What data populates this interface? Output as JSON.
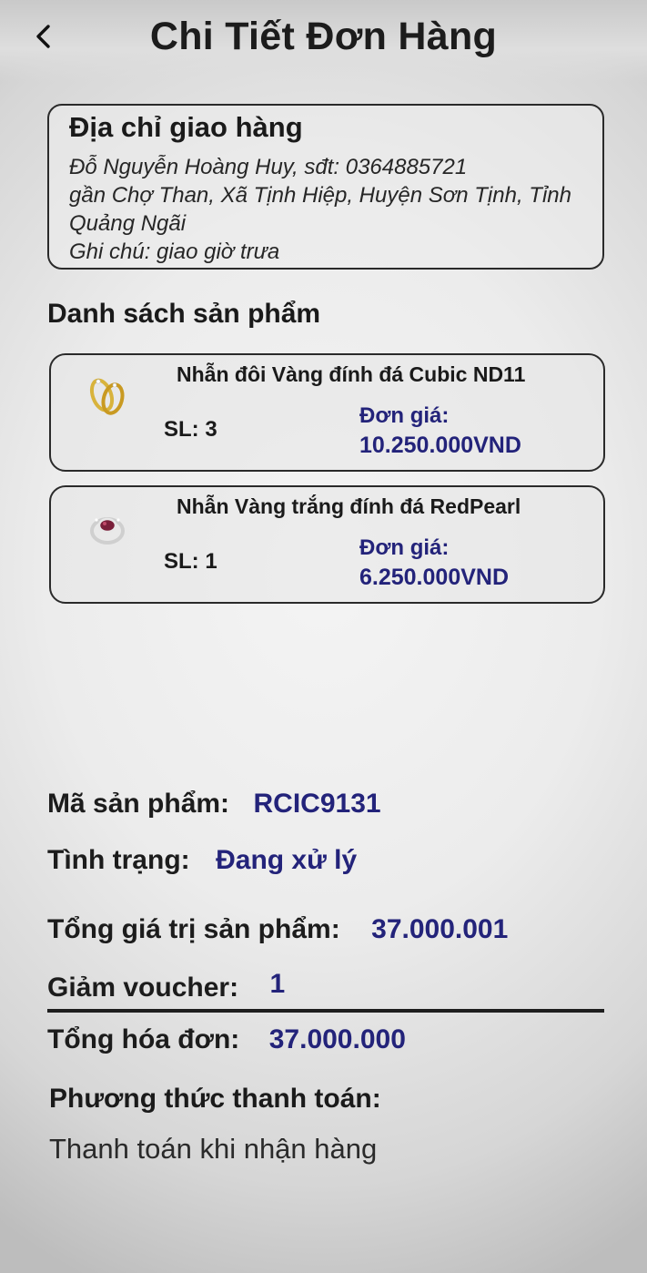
{
  "header": {
    "title": "Chi Tiết Đơn Hàng",
    "back_icon": "chevron-left-icon"
  },
  "address": {
    "title": "Địa chỉ giao hàng",
    "lines": [
      "Đỗ Nguyễn Hoàng Huy, sđt: 0364885721",
      "gần Chợ Than, Xã Tịnh Hiệp, Huyện Sơn Tịnh, Tỉnh",
      "Quảng Ngãi",
      "Ghi chú: giao giờ trưa"
    ]
  },
  "products": {
    "section_title": "Danh sách sản phẩm",
    "items": [
      {
        "name": "Nhẫn đôi Vàng đính đá Cubic ND11",
        "qty": "SL: 3",
        "price_label": "Đơn giá:",
        "price": "10.250.000VND",
        "thumb_icon": "gold-couple-ring-icon"
      },
      {
        "name": "Nhẫn Vàng trắng đính đá RedPearl",
        "qty": "SL: 1",
        "price_label": "Đơn giá:",
        "price": "6.250.000VND",
        "thumb_icon": "white-gold-red-stone-ring-icon"
      }
    ]
  },
  "order": {
    "code_label": "Mã sản phẩm:",
    "code_value": "RCIC9131",
    "status_label": "Tình trạng:",
    "status_value": "Đang xử lý",
    "subtotal_label": "Tổng giá trị sản phẩm:",
    "subtotal_value": "37.000.001",
    "voucher_label": "Giảm voucher:",
    "voucher_value": "1",
    "total_label": "Tổng hóa đơn:",
    "total_value": "37.000.000",
    "payment_label": "Phương thức thanh toán:",
    "payment_value": "Thanh toán khi nhận hàng"
  },
  "colors": {
    "accent_value": "#23237a",
    "border": "#2a2a2a"
  }
}
